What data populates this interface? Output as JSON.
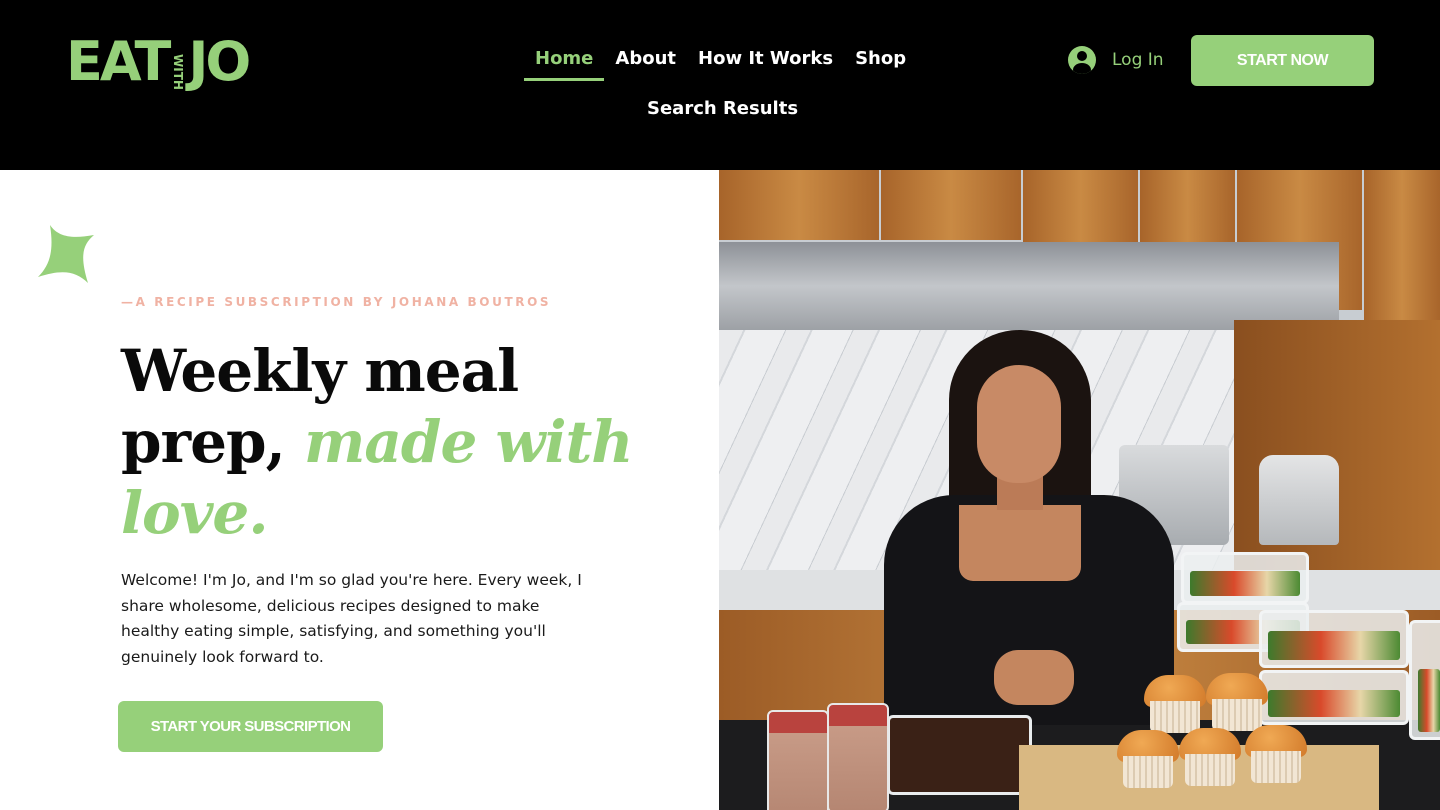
{
  "header": {
    "logo": {
      "main_left": "EAT",
      "with": "WITH",
      "main_right": "JO"
    },
    "nav": [
      {
        "label": "Home",
        "active": true
      },
      {
        "label": "About",
        "active": false
      },
      {
        "label": "How It Works",
        "active": false
      },
      {
        "label": "Shop",
        "active": false
      },
      {
        "label": "Search Results",
        "active": false
      }
    ],
    "login": {
      "label": "Log In",
      "icon": "account-icon"
    },
    "cta_label": "START NOW"
  },
  "hero": {
    "eyebrow": "—A RECIPE SUBSCRIPTION BY JOHANA BOUTROS",
    "headline_plain_1": "Weekly meal",
    "headline_plain_2": "prep, ",
    "headline_accent": "made with love.",
    "intro": "Welcome! I'm Jo, and I'm so glad you're here. Every week, I share wholesome, delicious recipes designed to make healthy eating simple, satisfying, and something you'll genuinely look forward to.",
    "cta_label": "START YOUR SUBSCRIPTION",
    "decor_icon": "sparkle-star-icon",
    "image_alt": "Jo smiling in a kitchen with meal prep containers, muffins and smoothies"
  },
  "colors": {
    "accent": "#96d07a",
    "eyebrow": "#f0b2a3",
    "header_bg": "#000000",
    "text": "#0a0a0a"
  }
}
